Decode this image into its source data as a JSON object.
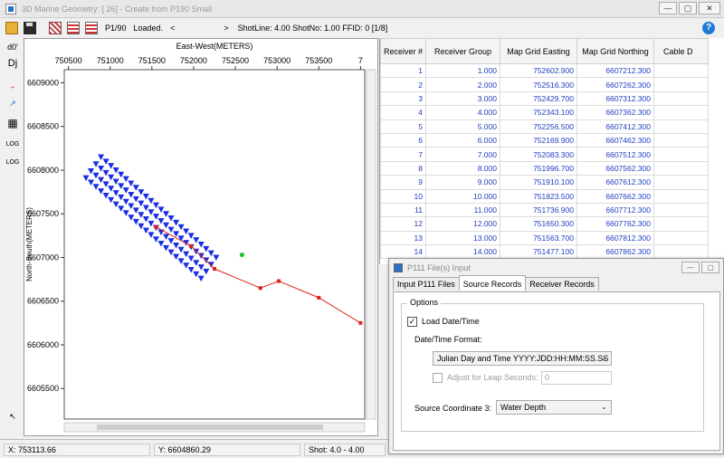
{
  "window": {
    "title": "3D Marine Geometry: [ 26] - Create from P190 Small"
  },
  "toolbar": {
    "line_label": "P1/90",
    "status": "Loaded.",
    "prev_arrow": "<",
    "next_arrow": ">",
    "shot_info": "ShotLine: 4.00 ShotNo: 1.00 FFID: 0 [1/8]",
    "help": "?"
  },
  "window_buttons": {
    "minimize": "—",
    "maximize": "▢",
    "close": "✕"
  },
  "left_tools": [
    "d0'",
    "Dj",
    "LOG",
    "LOG"
  ],
  "plot": {
    "chart_data": {
      "type": "scatter",
      "xlabel": "East-West(METERS)",
      "ylabel": "North-South(METERS)",
      "x_ticks": [
        "750500",
        "751000",
        "751500",
        "752000",
        "752500",
        "753000",
        "753500",
        "7"
      ],
      "y_ticks": [
        "6609000",
        "6608500",
        "6608000",
        "6607500",
        "6607000",
        "6606500",
        "6606000",
        "6605500"
      ],
      "xlim": [
        750450,
        754050
      ],
      "ylim": [
        6605150,
        6609150
      ],
      "series": [
        {
          "marker": "triangle-down",
          "color": "#1a2ee6",
          "points": [
            [
              750890,
              6608150
            ],
            [
              750950,
              6608100
            ],
            [
              751010,
              6608050
            ],
            [
              751070,
              6608000
            ],
            [
              751130,
              6607950
            ],
            [
              751190,
              6607900
            ],
            [
              751250,
              6607850
            ],
            [
              751310,
              6607800
            ],
            [
              751370,
              6607750
            ],
            [
              751430,
              6607700
            ],
            [
              751490,
              6607650
            ],
            [
              751550,
              6607600
            ],
            [
              751610,
              6607550
            ],
            [
              751670,
              6607500
            ],
            [
              751730,
              6607450
            ],
            [
              751790,
              6607400
            ],
            [
              751850,
              6607350
            ],
            [
              751910,
              6607300
            ],
            [
              751970,
              6607250
            ],
            [
              752030,
              6607200
            ],
            [
              752090,
              6607150
            ],
            [
              752150,
              6607100
            ],
            [
              752210,
              6607050
            ],
            [
              752270,
              6607000
            ],
            [
              750830,
              6608070
            ],
            [
              750890,
              6608020
            ],
            [
              750950,
              6607970
            ],
            [
              751010,
              6607920
            ],
            [
              751070,
              6607870
            ],
            [
              751130,
              6607820
            ],
            [
              751190,
              6607770
            ],
            [
              751250,
              6607720
            ],
            [
              751310,
              6607670
            ],
            [
              751370,
              6607620
            ],
            [
              751430,
              6607570
            ],
            [
              751490,
              6607520
            ],
            [
              751550,
              6607470
            ],
            [
              751610,
              6607420
            ],
            [
              751670,
              6607370
            ],
            [
              751730,
              6607320
            ],
            [
              751790,
              6607270
            ],
            [
              751850,
              6607220
            ],
            [
              751910,
              6607170
            ],
            [
              751970,
              6607120
            ],
            [
              752030,
              6607070
            ],
            [
              752090,
              6607020
            ],
            [
              752150,
              6606970
            ],
            [
              752210,
              6606920
            ],
            [
              750770,
              6607990
            ],
            [
              750830,
              6607940
            ],
            [
              750890,
              6607890
            ],
            [
              750950,
              6607840
            ],
            [
              751010,
              6607790
            ],
            [
              751070,
              6607740
            ],
            [
              751130,
              6607690
            ],
            [
              751190,
              6607640
            ],
            [
              751250,
              6607590
            ],
            [
              751310,
              6607540
            ],
            [
              751370,
              6607490
            ],
            [
              751430,
              6607440
            ],
            [
              751490,
              6607390
            ],
            [
              751550,
              6607340
            ],
            [
              751610,
              6607290
            ],
            [
              751670,
              6607240
            ],
            [
              751730,
              6607190
            ],
            [
              751790,
              6607140
            ],
            [
              751850,
              6607090
            ],
            [
              751910,
              6607040
            ],
            [
              751970,
              6606990
            ],
            [
              752030,
              6606940
            ],
            [
              752090,
              6606890
            ],
            [
              752150,
              6606840
            ],
            [
              750710,
              6607910
            ],
            [
              750770,
              6607860
            ],
            [
              750830,
              6607810
            ],
            [
              750890,
              6607760
            ],
            [
              750950,
              6607710
            ],
            [
              751010,
              6607660
            ],
            [
              751070,
              6607610
            ],
            [
              751130,
              6607560
            ],
            [
              751190,
              6607510
            ],
            [
              751250,
              6607460
            ],
            [
              751310,
              6607410
            ],
            [
              751370,
              6607360
            ],
            [
              751430,
              6607310
            ],
            [
              751490,
              6607260
            ],
            [
              751550,
              6607210
            ],
            [
              751610,
              6607160
            ],
            [
              751670,
              6607110
            ],
            [
              751730,
              6607060
            ],
            [
              751790,
              6607010
            ],
            [
              751850,
              6606960
            ],
            [
              751910,
              6606910
            ],
            [
              751970,
              6606860
            ],
            [
              752030,
              6606810
            ],
            [
              752090,
              6606760
            ]
          ]
        },
        {
          "marker": "square",
          "color": "#e0201a",
          "line": true,
          "points": [
            [
              751550,
              6607350
            ],
            [
              751970,
              6607130
            ],
            [
              752250,
              6606870
            ],
            [
              752800,
              6606650
            ],
            [
              753020,
              6606730
            ],
            [
              753500,
              6606540
            ],
            [
              754000,
              6606250
            ]
          ]
        },
        {
          "marker": "circle",
          "color": "#22c02a",
          "points": [
            [
              752580,
              6607030
            ]
          ]
        }
      ]
    }
  },
  "table": {
    "headers": [
      "Receiver #",
      "Receiver Group",
      "Map Grid Easting",
      "Map Grid Northing",
      "Cable D"
    ],
    "rows": [
      [
        "1",
        "1.000",
        "752602.900",
        "6607212.300"
      ],
      [
        "2",
        "2.000",
        "752516.300",
        "6607262.300"
      ],
      [
        "3",
        "3.000",
        "752429.700",
        "6607312.300"
      ],
      [
        "4",
        "4.000",
        "752343.100",
        "6607362.300"
      ],
      [
        "5",
        "5.000",
        "752256.500",
        "6607412.300"
      ],
      [
        "6",
        "6.000",
        "752169.900",
        "6607462.300"
      ],
      [
        "7",
        "7.000",
        "752083.300",
        "6607512.300"
      ],
      [
        "8",
        "8.000",
        "751996.700",
        "6607562.300"
      ],
      [
        "9",
        "9.000",
        "751910.100",
        "6607612.300"
      ],
      [
        "10",
        "10.000",
        "751823.500",
        "6607662.300"
      ],
      [
        "11",
        "11.000",
        "751736.900",
        "6607712.300"
      ],
      [
        "12",
        "12.000",
        "751650.300",
        "6607762.300"
      ],
      [
        "13",
        "13.000",
        "751563.700",
        "6607812.300"
      ],
      [
        "14",
        "14.000",
        "751477.100",
        "6607862.300"
      ]
    ]
  },
  "status": {
    "x": "X:     753113.66",
    "y": "Y:     6604860.29",
    "shot": "Shot: 4.0 - 4.00"
  },
  "dialog": {
    "title": "P111 File(s) Input",
    "tabs": [
      "Input P111 Files",
      "Source Records",
      "Receiver Records"
    ],
    "group_label": "Options",
    "load_date_label": "Load Date/Time",
    "load_date_checked": "✓",
    "format_label": "Date/Time Format:",
    "format_value": "Julian Day and Time YYYY:JDD:HH:MM:SS.SS",
    "leap_label": "Adjust for Leap Seconds:",
    "leap_value": "0",
    "coord_label": "Source Coordinate 3:",
    "coord_value": "Water Depth"
  }
}
